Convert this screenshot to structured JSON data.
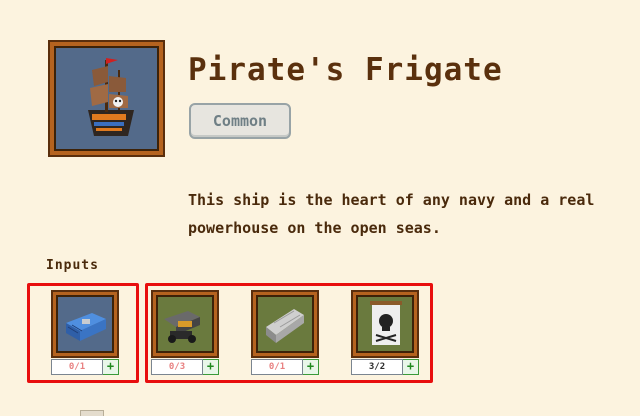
{
  "building": {
    "name": "Pirate's Frigate",
    "rarity": "Common",
    "description": "This ship is the heart of any navy and a real powerhouse on the open seas.",
    "portrait_icon": "pirate-frigate-icon"
  },
  "inputs": {
    "label": "Inputs",
    "items": [
      {
        "icon": "blue-crate-icon",
        "count": "0/1",
        "status": "short"
      },
      {
        "icon": "cannon-icon",
        "count": "0/3",
        "status": "short"
      },
      {
        "icon": "stone-slab-icon",
        "count": "0/1",
        "status": "short"
      },
      {
        "icon": "pirate-flag-icon",
        "count": "3/2",
        "status": "ok"
      }
    ],
    "add_label": "+"
  },
  "colors": {
    "background": "#fcf3df",
    "frame": "#b5631f",
    "highlight": "#e80e0e",
    "short_count": "#e88080",
    "add_green": "#1f8a1f"
  }
}
